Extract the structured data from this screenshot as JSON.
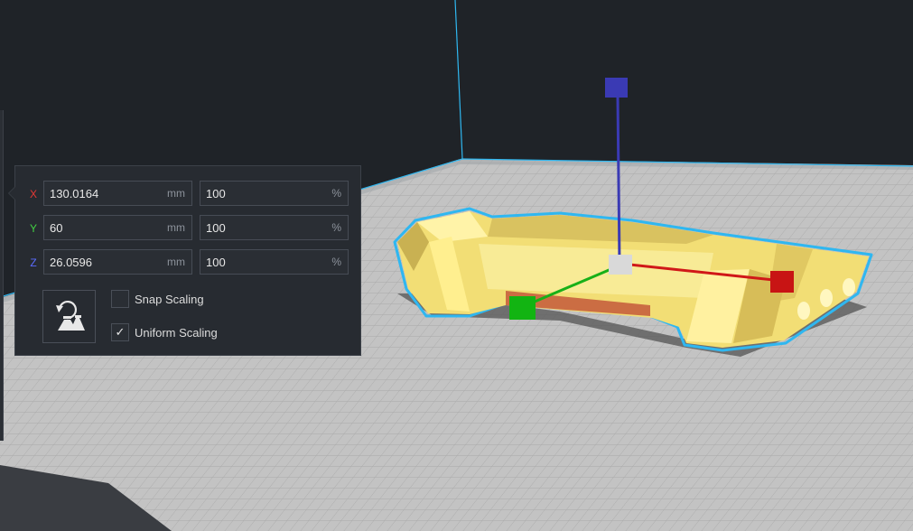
{
  "scale_panel": {
    "axes": [
      {
        "axis": "X",
        "value": "130.0164",
        "unit": "mm",
        "percent": "100",
        "percent_unit": "%",
        "color": "#e53935"
      },
      {
        "axis": "Y",
        "value": "60",
        "unit": "mm",
        "percent": "100",
        "percent_unit": "%",
        "color": "#43d043"
      },
      {
        "axis": "Z",
        "value": "26.0596",
        "unit": "mm",
        "percent": "100",
        "percent_unit": "%",
        "color": "#5b6cff"
      }
    ],
    "snap_scaling": {
      "label": "Snap Scaling",
      "checked": false
    },
    "uniform_scaling": {
      "label": "Uniform Scaling",
      "checked": true,
      "mark": "✓"
    },
    "lay_flat_icon": "scale-reset-icon"
  },
  "viewport": {
    "background": "#1f2328",
    "build_plate_color": "#bfbfbf",
    "model_color": "#f5e27a",
    "outline_color": "#2fb7f0",
    "handle_colors": {
      "x": "#d01818",
      "y": "#18b018",
      "z": "#3a3ab4",
      "center": "#d9d9d9"
    }
  }
}
